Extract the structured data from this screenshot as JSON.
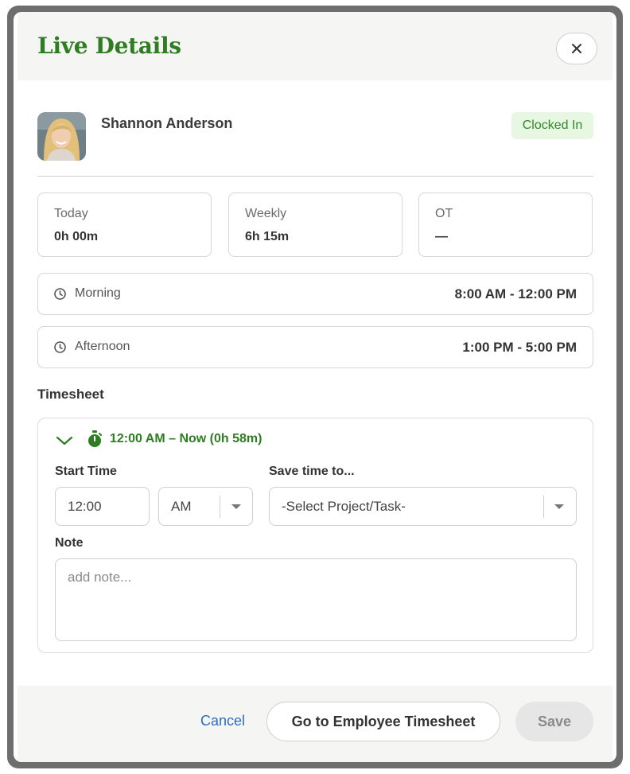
{
  "modal": {
    "title": "Live Details",
    "close_icon": "close-icon"
  },
  "employee": {
    "name": "Shannon Anderson",
    "status": "Clocked In",
    "avatar_icon": "avatar"
  },
  "stats": [
    {
      "label": "Today",
      "value": "0h 00m"
    },
    {
      "label": "Weekly",
      "value": "6h 15m"
    },
    {
      "label": "OT",
      "value": "—"
    }
  ],
  "shifts": [
    {
      "label": "Morning",
      "time": "8:00 AM - 12:00 PM",
      "icon": "clock-icon"
    },
    {
      "label": "Afternoon",
      "time": "1:00 PM - 5:00 PM",
      "icon": "clock-icon"
    }
  ],
  "timesheet": {
    "section_title": "Timesheet",
    "entry_summary": "12:00 AM – Now (0h 58m)",
    "start_time_label": "Start Time",
    "start_time_value": "12:00",
    "ampm_value": "AM",
    "save_time_label": "Save time to...",
    "project_value": "-Select Project/Task-",
    "note_label": "Note",
    "note_placeholder": "add note..."
  },
  "footer": {
    "cancel_label": "Cancel",
    "goto_label": "Go to Employee Timesheet",
    "save_label": "Save"
  },
  "colors": {
    "accent_green": "#2e7d22",
    "status_bg": "#e7f7e2",
    "link_blue": "#2c6fc2"
  }
}
